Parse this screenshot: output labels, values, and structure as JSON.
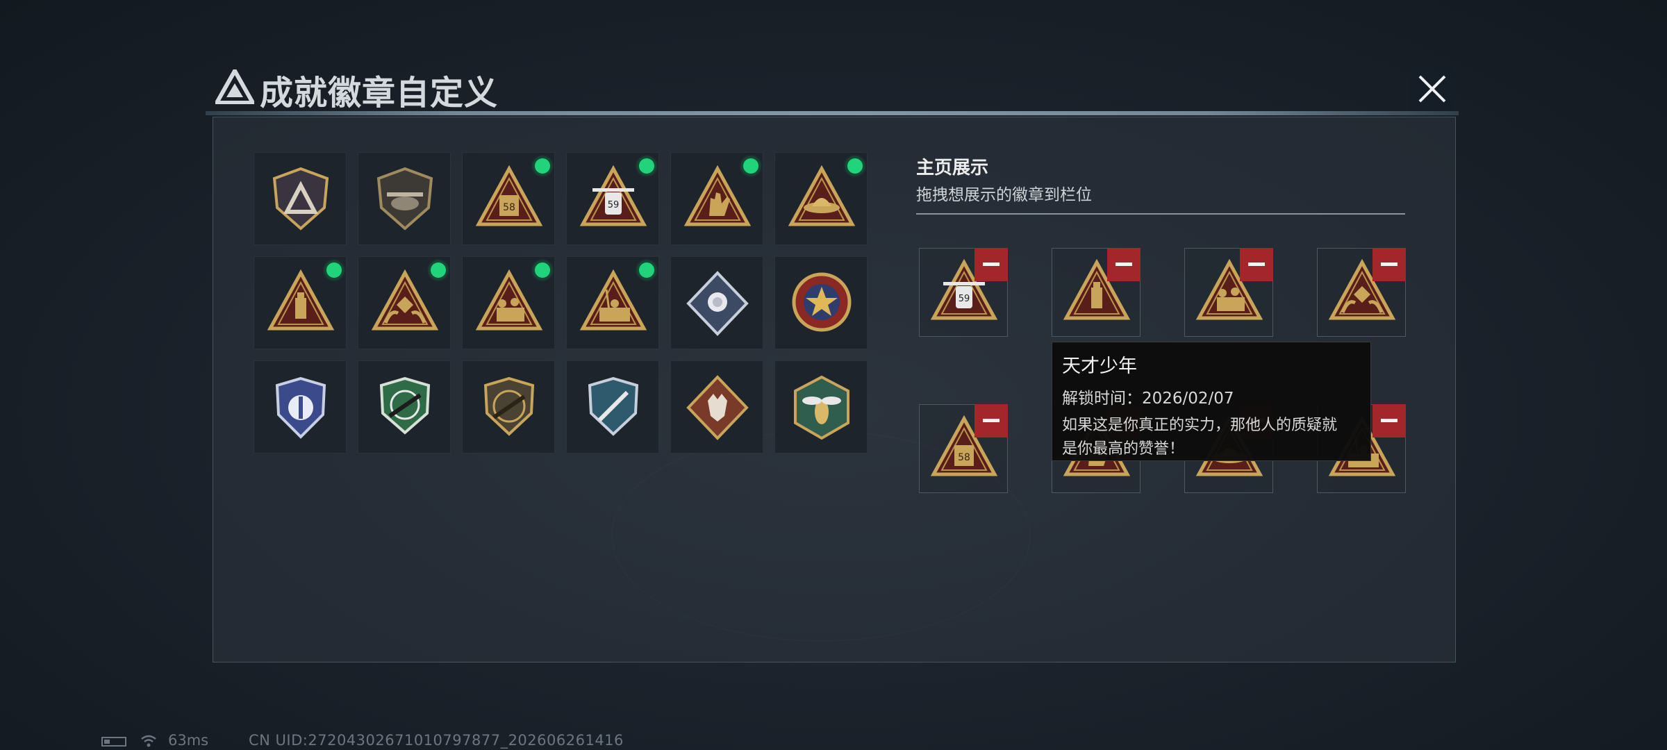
{
  "header": {
    "title": "成就徽章自定义",
    "logo_icon": "triangle-logo-icon",
    "close_icon": "close-icon"
  },
  "showcase": {
    "title": "主页展示",
    "subtitle": "拖拽想展示的徽章到栏位"
  },
  "badges": [
    {
      "icon": "shield-logo-badge-icon",
      "selected": false
    },
    {
      "icon": "helicopter-badge-icon",
      "selected": false
    },
    {
      "icon": "box-58-badge-icon",
      "selected": true,
      "number": "58"
    },
    {
      "icon": "drone-59-badge-icon",
      "selected": true,
      "number": "59"
    },
    {
      "icon": "hand-gesture-badge-icon",
      "selected": true
    },
    {
      "icon": "hat-badge-icon",
      "selected": true
    },
    {
      "icon": "usb-triangle-badge-icon",
      "selected": true
    },
    {
      "icon": "dice-hands-badge-icon",
      "selected": true
    },
    {
      "icon": "soldiers-badge-icon",
      "selected": true
    },
    {
      "icon": "soldiers-flag-badge-icon",
      "selected": true
    },
    {
      "icon": "rose-diamond-badge-icon",
      "selected": false
    },
    {
      "icon": "star-medal-badge-icon",
      "selected": false
    },
    {
      "icon": "blue-wings-badge-icon",
      "selected": false
    },
    {
      "icon": "green-rifle-badge-icon",
      "selected": false
    },
    {
      "icon": "bronze-rifle-badge-icon",
      "selected": false
    },
    {
      "icon": "blue-knife-badge-icon",
      "selected": false
    },
    {
      "icon": "wolf-badge-icon",
      "selected": false
    },
    {
      "icon": "hornet-badge-icon",
      "selected": false
    }
  ],
  "slots": [
    {
      "icon": "drone-59-badge-icon",
      "number": "59"
    },
    {
      "icon": "usb-triangle-badge-icon"
    },
    {
      "icon": "soldiers-badge-icon"
    },
    {
      "icon": "dice-hands-badge-icon"
    },
    {
      "icon": "box-58-badge-icon",
      "number": "58"
    },
    {
      "icon": "hand-gesture-badge-icon"
    },
    {
      "icon": "hat-badge-icon"
    },
    {
      "icon": "soldiers-flag-badge-icon"
    }
  ],
  "tooltip": {
    "title": "天才少年",
    "unlock_time": "解锁时间：2026/02/07",
    "description_line1": "如果这是你真正的实力，那他人的质疑就",
    "description_line2": "是你最高的赞誉！"
  },
  "status": {
    "ping": "63ms",
    "uid": "CN UID:27204302671010797877_202606261416"
  },
  "colors": {
    "accent_green": "#21d47c",
    "remove_red": "#a3262a",
    "gold": "#c9a55a"
  }
}
